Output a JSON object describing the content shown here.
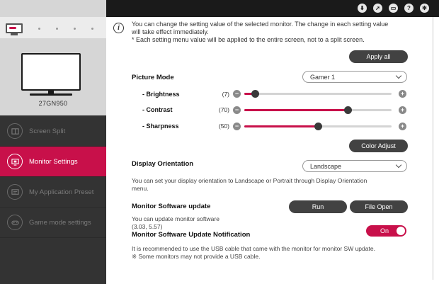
{
  "sidebar": {
    "model_name": "27GN950",
    "items": [
      {
        "label": "Screen Split",
        "icon": "screen-split-icon",
        "active": false
      },
      {
        "label": "Monitor Settings",
        "icon": "monitor-settings-icon",
        "active": true
      },
      {
        "label": "My Application Preset",
        "icon": "application-preset-icon",
        "active": false
      },
      {
        "label": "Game mode settings",
        "icon": "gamepad-icon",
        "active": false
      }
    ]
  },
  "topbar": {
    "icons": [
      "download-icon",
      "cursor-icon",
      "monitor-icon",
      "help-icon",
      "settings-icon"
    ]
  },
  "info": {
    "line1": "You can change the setting value of the selected monitor. The change in each setting value",
    "line2": "will take effect immediately.",
    "line3": "* Each setting menu value will be applied to the entire screen, not to a split screen."
  },
  "apply_all_label": "Apply all",
  "picture_mode": {
    "label": "Picture Mode",
    "value": "Gamer 1"
  },
  "sliders": [
    {
      "label": "- Brightness",
      "value_text": "(7)",
      "value": 7
    },
    {
      "label": "- Contrast",
      "value_text": "(70)",
      "value": 70
    },
    {
      "label": "- Sharpness",
      "value_text": "(50)",
      "value": 50
    }
  ],
  "color_adjust_label": "Color Adjust",
  "orientation": {
    "label": "Display Orientation",
    "value": "Landscape",
    "desc1": "You can set your display orientation to Landscape or Portrait through Display Orientation",
    "desc2": "menu."
  },
  "sw_update": {
    "label": "Monitor Software update",
    "run_label": "Run",
    "file_open_label": "File Open",
    "desc1": "You can update monitor software",
    "desc2": "(3.03, 5.57)"
  },
  "sw_notification": {
    "label": "Monitor Software Update Notification",
    "toggle_label": "On",
    "note1": "It is recommended to use the USB cable that came with the monitor for monitor SW update.",
    "note2": "※ Some monitors may not provide a USB cable."
  },
  "colors": {
    "accent": "#c8104a",
    "sidebar_bg": "#333333",
    "topbar_bg": "#1a1a1a",
    "button_bg": "#424242"
  }
}
